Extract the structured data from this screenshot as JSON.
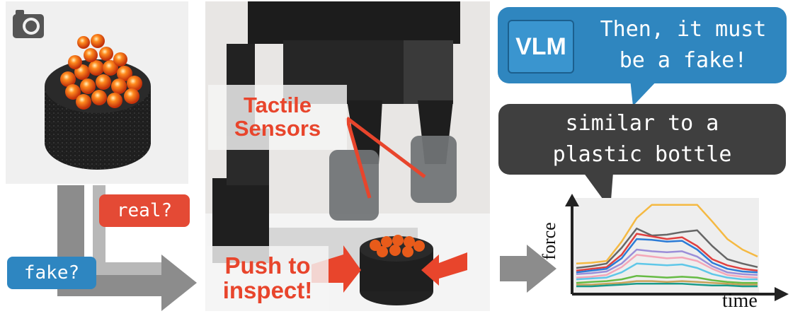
{
  "labels": {
    "query_real": "real?",
    "query_fake": "fake?",
    "tactile_sensors": [
      "Tactile",
      "Sensors"
    ],
    "push_to_inspect": [
      "Push to",
      "inspect!"
    ],
    "vlm_logo": "VLM",
    "vlm_reply": [
      "Then, it must",
      "be a fake!"
    ],
    "tactile_description": [
      "similar to a",
      "plastic bottle"
    ],
    "y_axis": "force",
    "x_axis": "time"
  },
  "colors": {
    "tag_red": "#e44a35",
    "tag_blue": "#2e86c1",
    "vlm_bubble": "#2f86bf",
    "description_bubble": "#3f3f3f",
    "arrow_gray": "#8a8a8a",
    "label_red": "#e8452c"
  },
  "chart_data": {
    "type": "line",
    "xlabel": "time",
    "ylabel": "force",
    "grid": false,
    "series": [
      {
        "color": "#f5b942",
        "values": [
          0.3,
          0.31,
          0.33,
          0.55,
          0.82,
          0.97,
          0.97,
          0.97,
          0.97,
          0.78,
          0.58,
          0.46,
          0.38
        ]
      },
      {
        "color": "#666666",
        "values": [
          0.25,
          0.27,
          0.3,
          0.48,
          0.7,
          0.62,
          0.63,
          0.66,
          0.68,
          0.5,
          0.35,
          0.3,
          0.26
        ]
      },
      {
        "color": "#e04040",
        "values": [
          0.22,
          0.24,
          0.26,
          0.4,
          0.64,
          0.61,
          0.58,
          0.6,
          0.5,
          0.35,
          0.28,
          0.24,
          0.22
        ]
      },
      {
        "color": "#2b7bd6",
        "values": [
          0.2,
          0.22,
          0.24,
          0.36,
          0.58,
          0.57,
          0.55,
          0.56,
          0.46,
          0.31,
          0.24,
          0.21,
          0.2
        ]
      },
      {
        "color": "#9b8ed8",
        "values": [
          0.18,
          0.19,
          0.21,
          0.3,
          0.46,
          0.44,
          0.43,
          0.44,
          0.38,
          0.27,
          0.2,
          0.18,
          0.17
        ]
      },
      {
        "color": "#f4a6b8",
        "values": [
          0.14,
          0.15,
          0.17,
          0.26,
          0.4,
          0.38,
          0.36,
          0.37,
          0.33,
          0.24,
          0.17,
          0.15,
          0.14
        ]
      },
      {
        "color": "#5fc7e8",
        "values": [
          0.12,
          0.13,
          0.14,
          0.2,
          0.3,
          0.29,
          0.28,
          0.29,
          0.25,
          0.18,
          0.14,
          0.12,
          0.12
        ]
      },
      {
        "color": "#66bb44",
        "values": [
          0.08,
          0.09,
          0.1,
          0.12,
          0.16,
          0.15,
          0.14,
          0.15,
          0.14,
          0.11,
          0.09,
          0.08,
          0.08
        ]
      },
      {
        "color": "#c7a35a",
        "values": [
          0.06,
          0.06,
          0.07,
          0.08,
          0.1,
          0.1,
          0.09,
          0.1,
          0.09,
          0.08,
          0.07,
          0.06,
          0.06
        ]
      },
      {
        "color": "#1a9b8a",
        "values": [
          0.04,
          0.04,
          0.05,
          0.06,
          0.07,
          0.07,
          0.07,
          0.07,
          0.06,
          0.05,
          0.05,
          0.04,
          0.04
        ]
      }
    ]
  }
}
